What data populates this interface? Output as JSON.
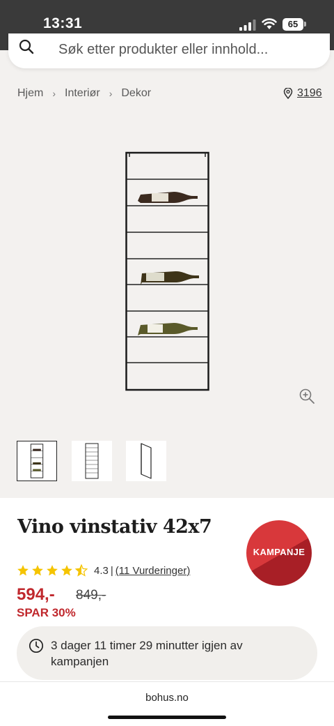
{
  "status_bar": {
    "time": "13:31",
    "battery": "65"
  },
  "search": {
    "placeholder": "Søk etter produkter eller innhold..."
  },
  "breadcrumb": {
    "items": [
      "Hjem",
      "Interiør",
      "Dekor"
    ]
  },
  "store": {
    "label": "3196"
  },
  "gallery": {
    "thumbnails": [
      "thumb-front-with-bottles",
      "thumb-front-empty",
      "thumb-side-angle"
    ],
    "active_index": 0
  },
  "product": {
    "title": "Vino vinstativ 42x7",
    "badge": "KAMPANJE",
    "rating": {
      "value": "4.3",
      "separator": "|",
      "count_label": "(11 Vurderinger)",
      "stars": 4.3
    },
    "price": "594,-",
    "old_price": "849,-",
    "saving": "SPAR 30%",
    "countdown": "3 dager 11 timer 29 minutter igjen av kampanjen"
  },
  "browser": {
    "url": "bohus.no"
  },
  "colors": {
    "sale_red": "#c0282d",
    "star_yellow": "#f5c400",
    "status_bar": "#3a3a3a"
  }
}
